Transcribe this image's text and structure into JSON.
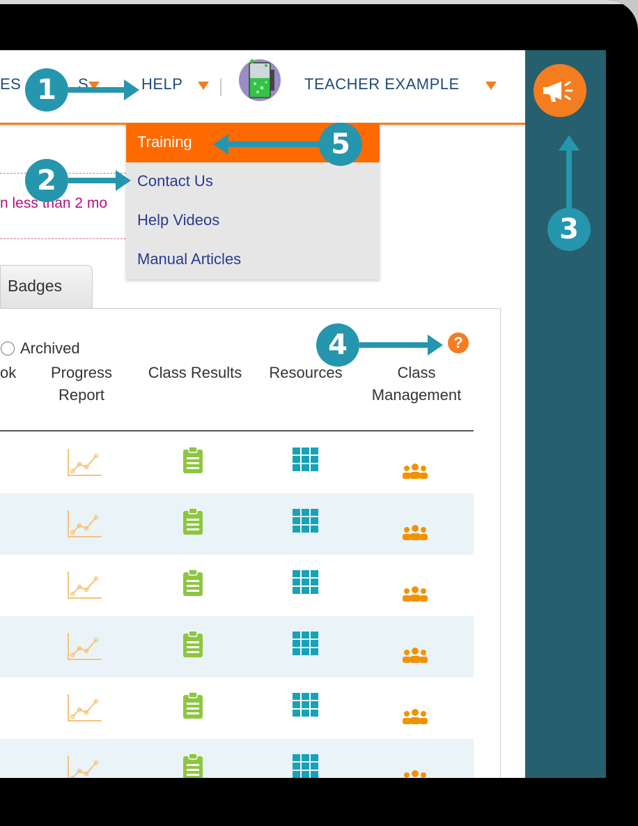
{
  "nav": {
    "partial_left": "ES",
    "partial_mid": "S",
    "help_label": "HELP",
    "user_label": "TEACHER EXAMPLE",
    "divider": "|"
  },
  "help_menu": {
    "items": [
      {
        "label": "Training",
        "active": true
      },
      {
        "label": "Contact Us"
      },
      {
        "label": "Help Videos"
      },
      {
        "label": "Manual Articles"
      }
    ]
  },
  "notice": {
    "text": "n less than 2 mo"
  },
  "tabs": {
    "badges": "Badges"
  },
  "filter": {
    "archived_label": "Archived"
  },
  "help_icon": "?",
  "columns": [
    {
      "line1": "",
      "line2": "ok"
    },
    {
      "line1": "Progress",
      "line2": "Report"
    },
    {
      "line1": "",
      "line2": "Class Results"
    },
    {
      "line1": "",
      "line2": "Resources"
    },
    {
      "line1": "Class",
      "line2": "Management"
    }
  ],
  "rows": [
    {
      "progress": "chart-icon",
      "results": "clipboard-icon",
      "resources": "grid-icon",
      "management": "users-icon"
    },
    {
      "progress": "chart-icon",
      "results": "clipboard-icon",
      "resources": "grid-icon",
      "management": "users-icon"
    },
    {
      "progress": "chart-icon",
      "results": "clipboard-icon",
      "resources": "grid-icon",
      "management": "users-icon"
    },
    {
      "progress": "chart-icon",
      "results": "clipboard-icon",
      "resources": "grid-icon",
      "management": "users-icon"
    },
    {
      "progress": "chart-icon",
      "results": "clipboard-icon",
      "resources": "grid-icon",
      "management": "users-icon"
    },
    {
      "progress": "chart-icon",
      "results": "clipboard-icon",
      "resources": "grid-icon",
      "management": "users-icon"
    }
  ],
  "callouts": [
    "1",
    "2",
    "3",
    "4",
    "5"
  ],
  "colors": {
    "accent_orange": "#f47d20",
    "dropdown_active": "#ff6a00",
    "sidebar": "#265f6d",
    "callout_blue": "#2596ad",
    "nav_text": "#1f4a7a",
    "link_text": "#2a3a8f",
    "notice_text": "#b3127d",
    "clipboard_green": "#8dc63f",
    "grid_teal": "#17a2b8",
    "users_orange": "#f39200",
    "chart_orange": "#f5c47a"
  }
}
